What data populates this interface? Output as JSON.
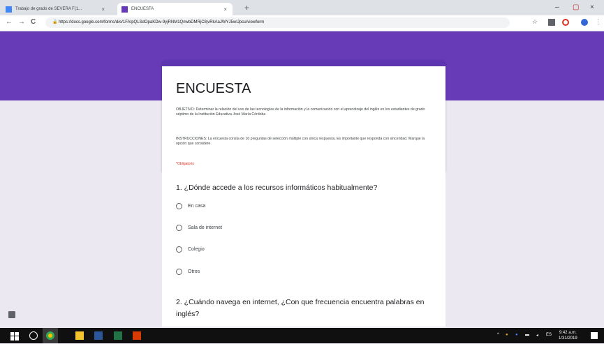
{
  "browser": {
    "tabs": [
      {
        "label": "Trabajo de grado de SEVERA F(1...",
        "close": "×"
      },
      {
        "label": "ENCUESTA",
        "close": "×"
      }
    ],
    "new_tab": "+",
    "window_controls": [
      "–",
      "▢",
      "×"
    ],
    "nav": {
      "back": "←",
      "forward": "→",
      "reload": "C"
    },
    "url": "https://docs.google.com/forms/d/e/1FAIpQLSdOpaKDw-9yjRNM1QnwbDMRjC8jvRkAaJWYJ5wIJpcu/viewform"
  },
  "form": {
    "title": "ENCUESTA",
    "objective": "OBJETIVO: Determinar la relación del uso de las tecnologías de la información y la comunicación con el aprendizaje del inglés en los estudiantes de grado séptimo de la Institución Educativa José María Córdoba",
    "instructions": "INSTRUCCIONES: La encuesta consta de 10 preguntas de selección múltiple con única respuesta. Es importante que responda con sinceridad. Marque la opción que considere.",
    "required": "*Obligatorio",
    "q1": {
      "text": "1. ¿Dónde accede a los recursos informáticos habitualmente?",
      "options": [
        "En casa",
        "Sala de internet",
        "Colegio",
        "Otros"
      ]
    },
    "q2": {
      "text": "2. ¿Cuándo navega en internet, ¿Con que frecuencia encuentra palabras en inglés?"
    }
  },
  "taskbar": {
    "clock_time": "9:42 a.m.",
    "clock_date": "1/31/2019"
  },
  "colors": {
    "header": "#673ab7",
    "accent": "#5e35b1",
    "background": "#ebe8f2"
  }
}
